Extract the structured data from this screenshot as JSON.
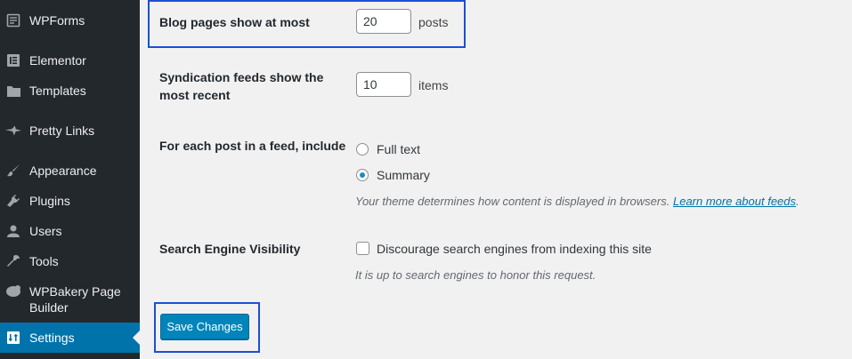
{
  "sidebar": {
    "items": [
      {
        "label": "WPForms",
        "icon": "wpforms-icon"
      },
      {
        "label": "Elementor",
        "icon": "elementor-icon"
      },
      {
        "label": "Templates",
        "icon": "folder-icon"
      },
      {
        "label": "Pretty Links",
        "icon": "star-icon"
      },
      {
        "label": "Appearance",
        "icon": "paintbrush-icon"
      },
      {
        "label": "Plugins",
        "icon": "plug-icon"
      },
      {
        "label": "Users",
        "icon": "user-icon"
      },
      {
        "label": "Tools",
        "icon": "wrench-icon"
      },
      {
        "label": "WPBakery Page",
        "label2": "Builder",
        "icon": "wpbakery-icon"
      },
      {
        "label": "Settings",
        "icon": "settings-icon",
        "active": true
      }
    ],
    "active_color": "#0073aa"
  },
  "settings": {
    "blog_pages": {
      "label": "Blog pages show at most",
      "value": "20",
      "suffix": "posts"
    },
    "syndication": {
      "label_line1": "Syndication feeds show the",
      "label_line2": "most recent",
      "value": "10",
      "suffix": "items"
    },
    "feed_content": {
      "label": "For each post in a feed, include",
      "options": [
        "Full text",
        "Summary"
      ],
      "selected": "Summary",
      "description": "Your theme determines how content is displayed in browsers.",
      "link_text": "Learn more about feeds",
      "link_suffix": "."
    },
    "search_visibility": {
      "label": "Search Engine Visibility",
      "checkbox_label": "Discourage search engines from indexing this site",
      "checked": false,
      "description": "It is up to search engines to honor this request."
    }
  },
  "save_button": {
    "label": "Save Changes"
  },
  "highlight_color": "#1c4fd6"
}
